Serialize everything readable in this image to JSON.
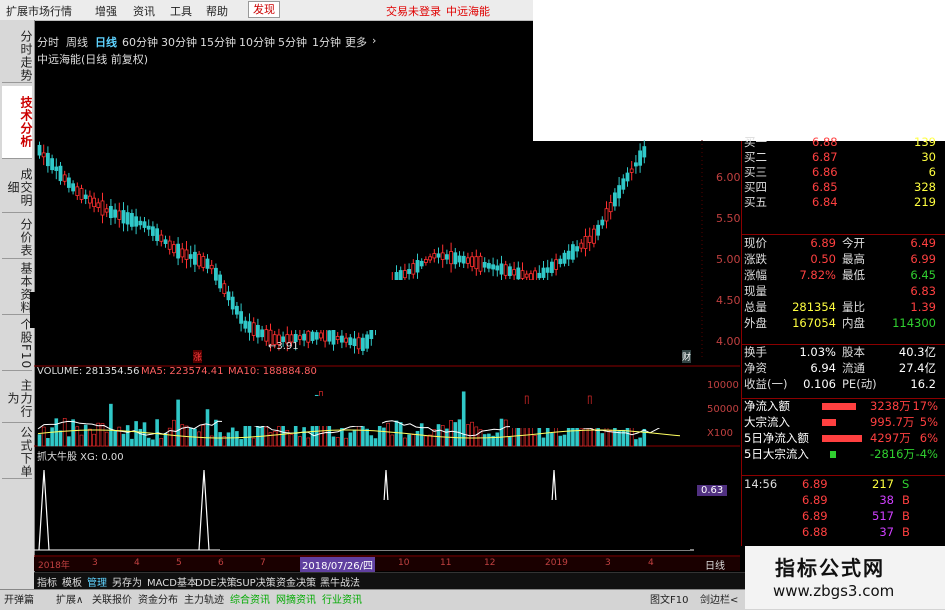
{
  "menubar": {
    "items": [
      "扩展市场行情",
      "增强",
      "资讯",
      "工具",
      "帮助"
    ],
    "active": "发现",
    "right_items": [
      "交易未登录",
      "中远海能"
    ]
  },
  "side_tabs": [
    "分时走势",
    "技术分析",
    "成交明细",
    "分价表",
    "基本资料",
    "个股F10",
    "主力行为",
    "公式下单"
  ],
  "side_active_index": 1,
  "periods": [
    "分时",
    "周线",
    "日线",
    "60分钟",
    "30分钟",
    "15分钟",
    "10分钟",
    "5分钟",
    "1分钟",
    "更多"
  ],
  "period_active": "日线",
  "chart_title": "中远海能(日线 前复权)",
  "price_axis": [
    "6.00",
    "5.50",
    "5.00",
    "4.50",
    "4.00"
  ],
  "low_label": "←3.91",
  "marks": {
    "zhang": "涨",
    "cai": "财"
  },
  "volume_line": {
    "vol": "VOLUME: 281354.56",
    "ma5": "MA5: 223574.41",
    "ma10": "MA10: 188884.80"
  },
  "vol_axis": [
    "10000",
    "50000",
    "X100"
  ],
  "indicator_title": "抓大牛股 XG: 0.00",
  "indicator_value": "0.63",
  "date_axis": {
    "labels": [
      "2018年",
      "3",
      "4",
      "5",
      "6",
      "7",
      "10",
      "11",
      "12",
      "2019",
      "3",
      "4"
    ],
    "cursor": "2018/07/26/四"
  },
  "day_tab": "日线",
  "bottom_tabs": [
    "指标",
    "模板",
    "管理",
    "另存为",
    "MACD基本",
    "DDE决策",
    "SUP决策",
    "资金决策",
    "黑牛战法"
  ],
  "bottom_tabs_active": "管理",
  "bottom_bar2": [
    "开弹篇",
    "扩展∧",
    "关联报价",
    "资金分布",
    "主力轨迹",
    "综合资讯",
    "网摘资讯",
    "行业资讯"
  ],
  "bottom_right": [
    "图文F10",
    "剑边栏<"
  ],
  "quote": {
    "buy": [
      {
        "label": "买一",
        "price": "6.88",
        "vol": "139"
      },
      {
        "label": "买二",
        "price": "6.87",
        "vol": "30"
      },
      {
        "label": "买三",
        "price": "6.86",
        "vol": "6"
      },
      {
        "label": "买四",
        "price": "6.85",
        "vol": "328"
      },
      {
        "label": "买五",
        "price": "6.84",
        "vol": "219"
      }
    ],
    "stats_left": [
      {
        "label": "现价",
        "value": "6.89"
      },
      {
        "label": "涨跌",
        "value": "0.50"
      },
      {
        "label": "涨幅",
        "value": "7.82%"
      },
      {
        "label": "现量",
        "value": ""
      },
      {
        "label": "总量",
        "value": "281354"
      },
      {
        "label": "外盘",
        "value": "167054"
      }
    ],
    "stats_right": [
      {
        "label": "今开",
        "value": "6.49"
      },
      {
        "label": "最高",
        "value": "6.99"
      },
      {
        "label": "最低",
        "value": "6.45"
      },
      {
        "label": "",
        "value": "6.83"
      },
      {
        "label": "量比",
        "value": "1.39"
      },
      {
        "label": "内盘",
        "value": "114300"
      }
    ],
    "fin": [
      {
        "l1": "换手",
        "v1": "1.03%",
        "l2": "股本",
        "v2": "40.3亿"
      },
      {
        "l1": "净资",
        "v1": "6.94",
        "l2": "流通",
        "v2": "27.4亿"
      },
      {
        "l1": "收益(一)",
        "v1": "0.106",
        "l2": "PE(动)",
        "v2": "16.2"
      }
    ],
    "flow": [
      {
        "label": "净流入额",
        "value": "3238万",
        "pct": "17%",
        "color": "#ff4040"
      },
      {
        "label": "大宗流入",
        "value": "995.7万",
        "pct": "5%",
        "color": "#ff4040"
      },
      {
        "label": "5日净流入额",
        "value": "4297万",
        "pct": "6%",
        "color": "#ff4040"
      },
      {
        "label": "5日大宗流入",
        "value": "-2816万",
        "pct": "-4%",
        "color": "#30d030"
      }
    ],
    "ticks": [
      {
        "time": "14:56",
        "price": "6.89",
        "vol": "217",
        "side": "S"
      },
      {
        "time": "",
        "price": "6.89",
        "vol": "38",
        "side": "B"
      },
      {
        "time": "",
        "price": "6.89",
        "vol": "517",
        "side": "B"
      },
      {
        "time": "",
        "price": "6.88",
        "vol": "37",
        "side": "B"
      }
    ]
  },
  "watermark": {
    "title": "指标公式网",
    "url": "www.zbgs3.com"
  },
  "colors": {
    "up": "#ff3030",
    "down": "#30c8c8",
    "ma": "#ffffff",
    "bg": "#000000",
    "border": "#8b0000"
  }
}
